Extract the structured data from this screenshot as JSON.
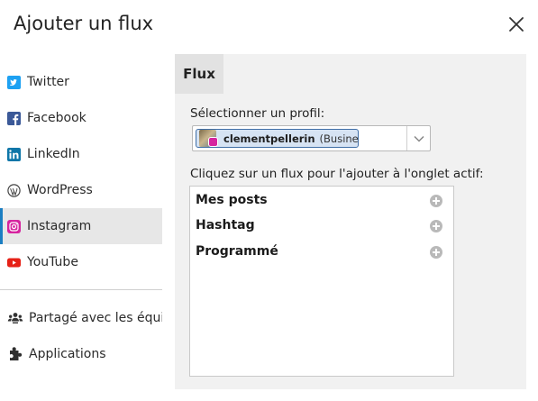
{
  "dialog": {
    "title": "Ajouter un flux"
  },
  "sidebar": {
    "networks": [
      {
        "label": "Twitter",
        "icon": "twitter-icon",
        "color": "#1da1f2"
      },
      {
        "label": "Facebook",
        "icon": "facebook-icon",
        "color": "#3b5998"
      },
      {
        "label": "LinkedIn",
        "icon": "linkedin-icon",
        "color": "#0e76a8"
      },
      {
        "label": "WordPress",
        "icon": "wordpress-icon",
        "color": "#464646"
      },
      {
        "label": "Instagram",
        "icon": "instagram-icon",
        "color": "#d6249f",
        "active": true
      },
      {
        "label": "YouTube",
        "icon": "youtube-icon",
        "color": "#e62117"
      }
    ],
    "shared": {
      "label": "Partagé avec les équipes",
      "icon": "team-icon"
    },
    "apps": {
      "label": "Applications",
      "icon": "puzzle-icon"
    }
  },
  "panel": {
    "tab_label": "Flux",
    "profile_label": "Sélectionner un profil:",
    "profile": {
      "name": "clementpellerin",
      "type": "(Business)"
    },
    "streams_label": "Cliquez sur un flux pour l'ajouter à l'onglet actif:",
    "streams": [
      {
        "label": "Mes posts"
      },
      {
        "label": "Hashtag"
      },
      {
        "label": "Programmé"
      }
    ]
  },
  "colors": {
    "accent": "#1b7ec2",
    "chip_bg": "#d6e3f3",
    "chip_border": "#3f6ea6",
    "panel_bg": "#f1f1f1"
  }
}
